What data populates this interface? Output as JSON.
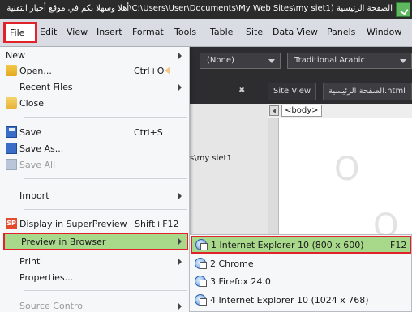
{
  "window": {
    "title": "الصفحة الرئيسية (C:\\Users\\User\\Documents\\My Web Sites\\my siet1\\أهلا وسهلا بكم في موقع أخبار التقنية"
  },
  "menubar": {
    "items": [
      "File",
      "Edit",
      "View",
      "Insert",
      "Format",
      "Tools",
      "Table",
      "Site",
      "Data View",
      "Panels",
      "Window"
    ]
  },
  "toolbar": {
    "style_combo": "(None)",
    "font_combo": "Traditional Arabic"
  },
  "tabs": {
    "site_view": "Site View",
    "doc_tab": "الصفحة الرئيسية.html"
  },
  "editor": {
    "breadcrumb_tag": "<body>",
    "path_fragment": "s\\my siet1"
  },
  "file_menu": {
    "items": [
      {
        "label": "New",
        "shortcut": "",
        "submenu": true,
        "icon": "",
        "disabled": false
      },
      {
        "label": "Open...",
        "shortcut": "Ctrl+O",
        "submenu": false,
        "icon": "folder-open-icon",
        "disabled": false
      },
      {
        "label": "Recent Files",
        "shortcut": "",
        "submenu": true,
        "icon": "",
        "disabled": false
      },
      {
        "label": "Close",
        "shortcut": "",
        "submenu": false,
        "icon": "folder-icon",
        "disabled": false
      },
      {
        "label": "Save",
        "shortcut": "Ctrl+S",
        "submenu": false,
        "icon": "save-icon",
        "disabled": false
      },
      {
        "label": "Save As...",
        "shortcut": "",
        "submenu": false,
        "icon": "save-as-icon",
        "disabled": false
      },
      {
        "label": "Save All",
        "shortcut": "",
        "submenu": false,
        "icon": "save-all-icon",
        "disabled": true
      },
      {
        "label": "Import",
        "shortcut": "",
        "submenu": true,
        "icon": "",
        "disabled": false
      },
      {
        "label": "Display in SuperPreview",
        "shortcut": "Shift+F12",
        "submenu": false,
        "icon": "superpreview-icon",
        "disabled": false
      },
      {
        "label": "Preview in Browser",
        "shortcut": "",
        "submenu": true,
        "icon": "",
        "disabled": false,
        "highlighted": true
      },
      {
        "label": "Print",
        "shortcut": "",
        "submenu": true,
        "icon": "",
        "disabled": false
      },
      {
        "label": "Properties...",
        "shortcut": "",
        "submenu": false,
        "icon": "",
        "disabled": false
      },
      {
        "label": "Source Control",
        "shortcut": "",
        "submenu": true,
        "icon": "",
        "disabled": true
      }
    ]
  },
  "preview_submenu": {
    "items": [
      {
        "label": "1 Internet Explorer 10 (800 x 600)",
        "shortcut": "F12",
        "icon": "browser-icon",
        "highlighted": true
      },
      {
        "label": "2 Chrome",
        "shortcut": "",
        "icon": "browser-icon"
      },
      {
        "label": "3 Firefox 24.0",
        "shortcut": "",
        "icon": "browser-icon"
      },
      {
        "label": "4 Internet Explorer 10 (1024 x 768)",
        "shortcut": "",
        "icon": "browser-icon"
      }
    ]
  },
  "colors": {
    "highlight_fill": "#a8d88a",
    "highlight_border": "#e0222a"
  }
}
